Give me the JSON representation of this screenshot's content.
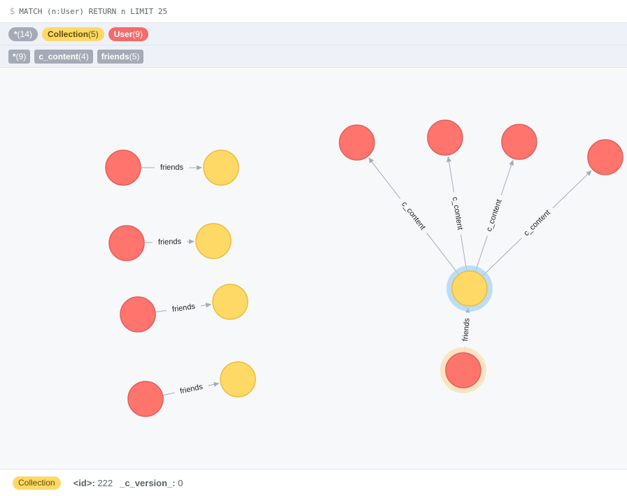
{
  "query": {
    "prompt": "$",
    "text": "MATCH (n:User) RETURN n LIMIT 25"
  },
  "node_labels": [
    {
      "name": "*",
      "count": "(14)",
      "color": "#a5abb6"
    },
    {
      "name": "Collection",
      "count": "(5)",
      "color": "#ffd966"
    },
    {
      "name": "User",
      "count": "(9)",
      "color": "#f46b6b"
    }
  ],
  "relationship_types": [
    {
      "name": "*",
      "count": "(9)"
    },
    {
      "name": "c_content",
      "count": "(4)"
    },
    {
      "name": "friends",
      "count": "(5)"
    }
  ],
  "graph": {
    "edges": [
      {
        "label": "friends"
      },
      {
        "label": "friends"
      },
      {
        "label": "friends"
      },
      {
        "label": "friends"
      },
      {
        "label": "c_content"
      },
      {
        "label": "c_content"
      },
      {
        "label": "c_content"
      },
      {
        "label": "c_content"
      },
      {
        "label": "friends"
      }
    ]
  },
  "footer": {
    "label": "Collection",
    "label_color": "#ffd966",
    "properties": [
      {
        "key": "<id>:",
        "value": "222"
      },
      {
        "key": "_c_version_:",
        "value": "0"
      }
    ]
  }
}
